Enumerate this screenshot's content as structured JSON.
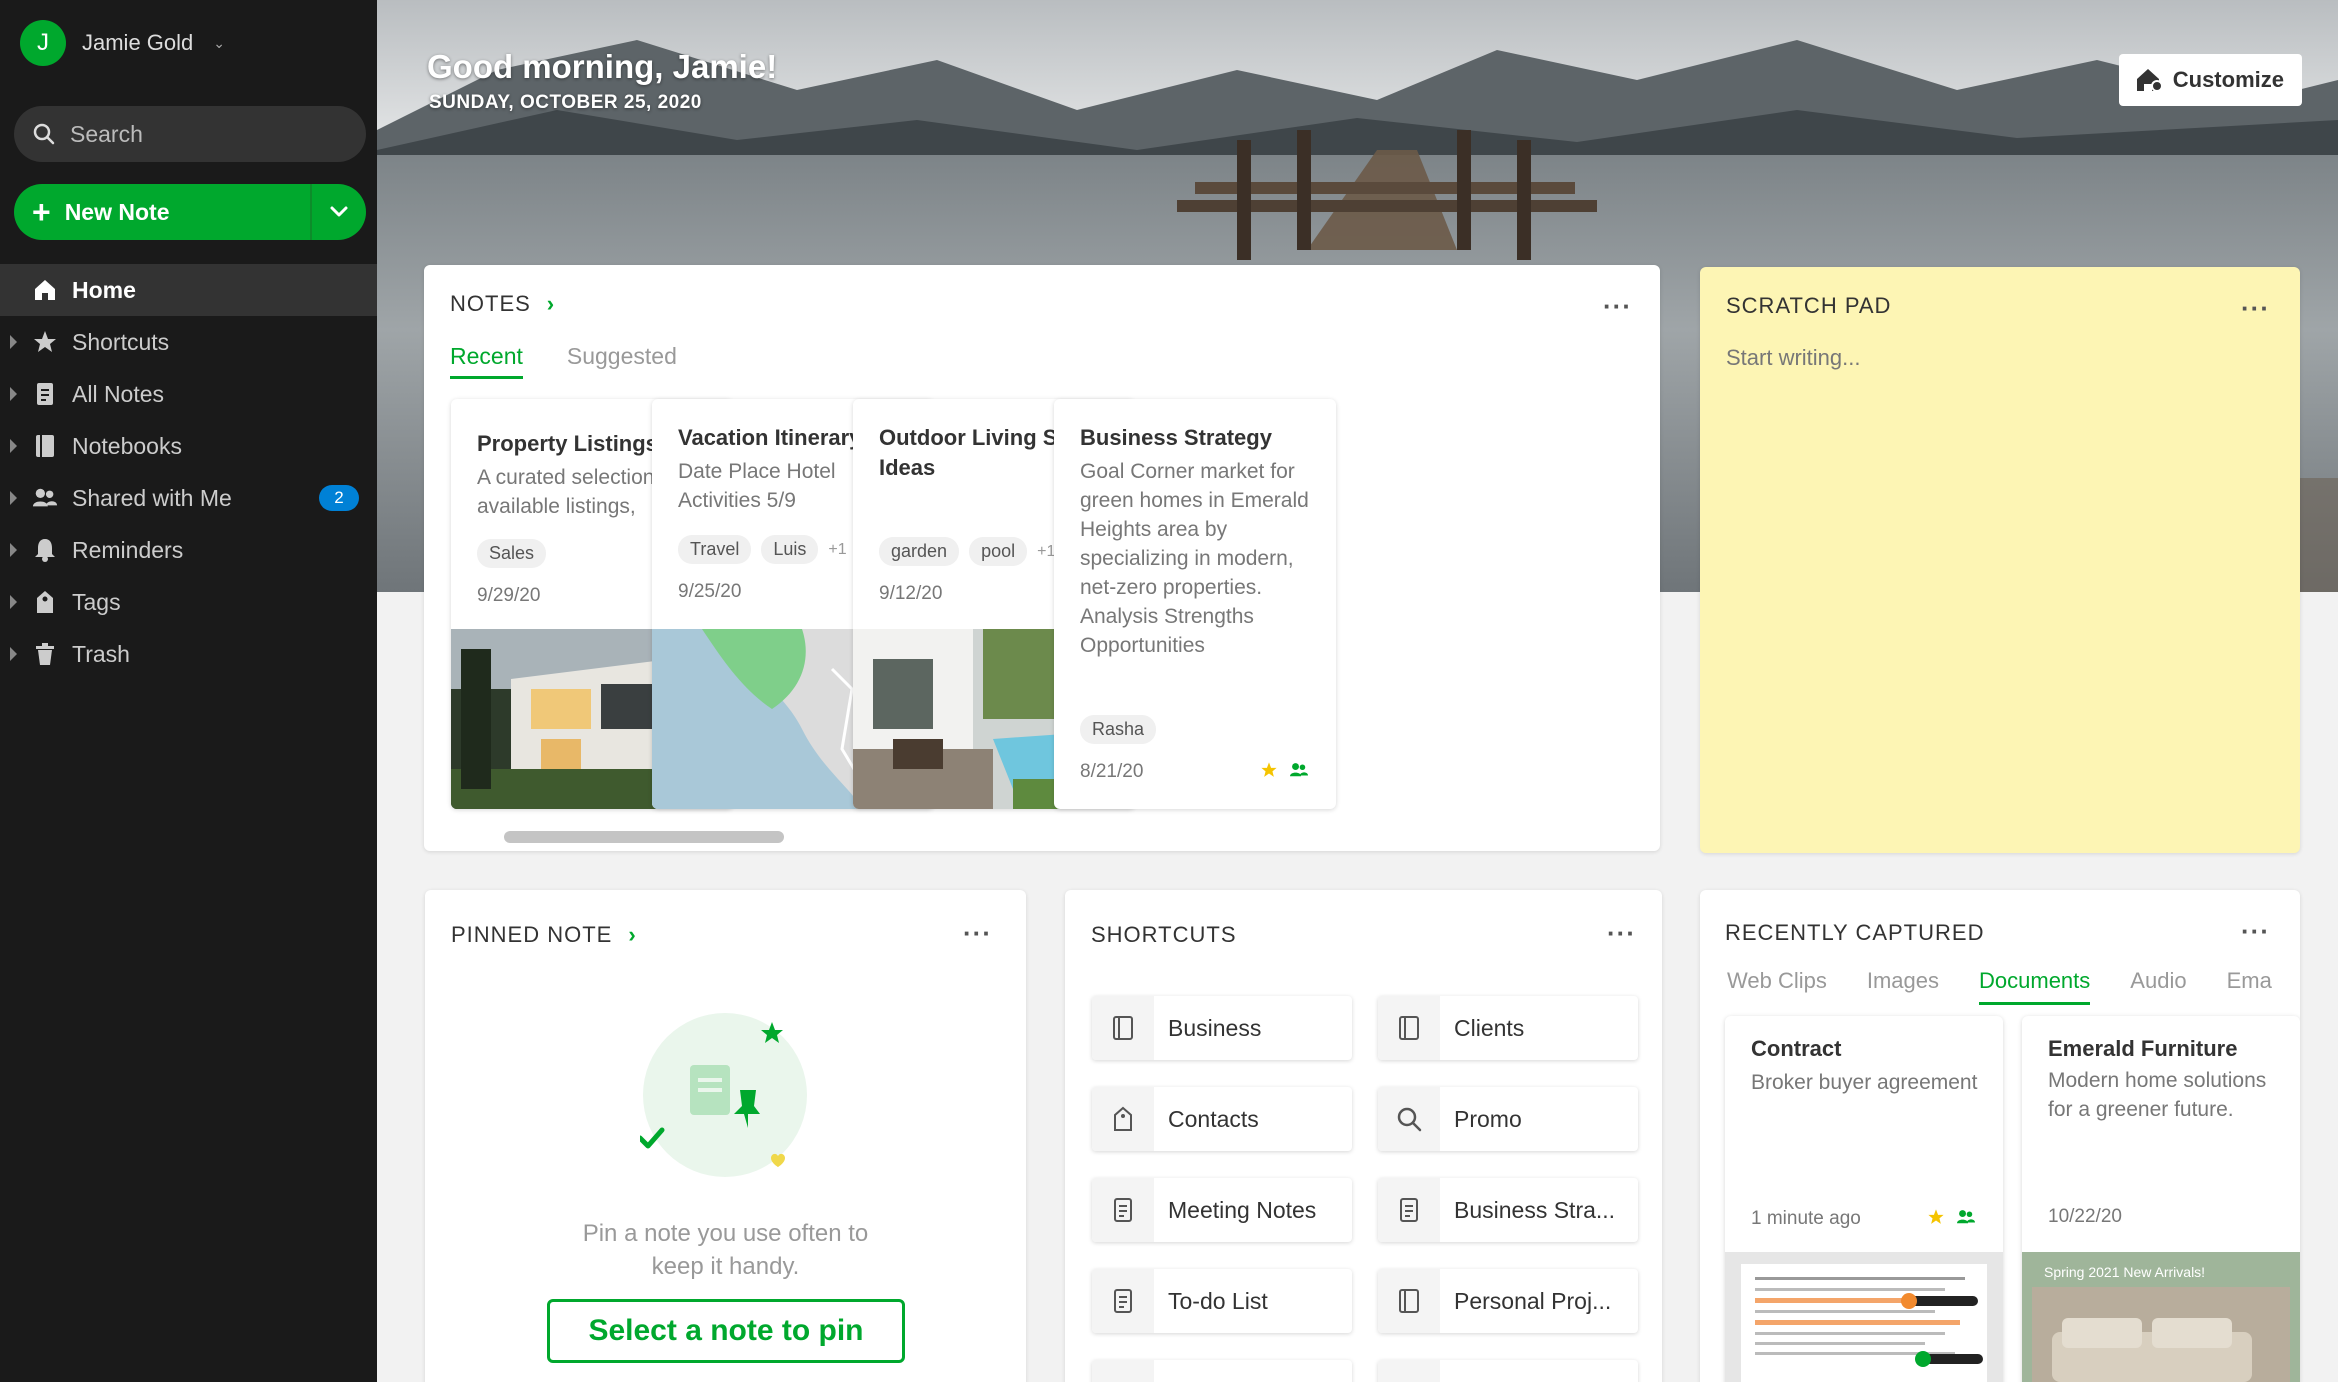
{
  "account": {
    "initial": "J",
    "name": "Jamie Gold"
  },
  "search": {
    "placeholder": "Search"
  },
  "new_note": {
    "label": "New Note"
  },
  "nav": [
    {
      "label": "Home",
      "icon": "home-icon"
    },
    {
      "label": "Shortcuts",
      "icon": "star-icon"
    },
    {
      "label": "All Notes",
      "icon": "note-icon"
    },
    {
      "label": "Notebooks",
      "icon": "notebook-icon"
    },
    {
      "label": "Shared with Me",
      "icon": "people-icon",
      "badge": "2"
    },
    {
      "label": "Reminders",
      "icon": "bell-icon"
    },
    {
      "label": "Tags",
      "icon": "tag-icon"
    },
    {
      "label": "Trash",
      "icon": "trash-icon"
    }
  ],
  "hero": {
    "greeting": "Good morning, Jamie!",
    "date": "SUNDAY, OCTOBER 25, 2020",
    "customize_label": "Customize"
  },
  "notes": {
    "title": "NOTES",
    "tabs": [
      "Recent",
      "Suggested"
    ],
    "items": [
      {
        "title": "Property Listings",
        "snippet": "A curated selection of available listings,",
        "tags": [
          "Sales"
        ],
        "tags_more": "",
        "date": "9/29/20"
      },
      {
        "title": "Vacation Itinerary",
        "snippet": "Date Place Hotel Activities 5/9",
        "tags": [
          "Travel",
          "Luis"
        ],
        "tags_more": "+1",
        "date": "9/25/20"
      },
      {
        "title": "Outdoor Living Space Ideas",
        "snippet": "",
        "tags": [
          "garden",
          "pool"
        ],
        "tags_more": "+1",
        "date": "9/12/20"
      },
      {
        "title": "Business Strategy",
        "snippet": "Goal Corner market for green homes in Emerald Heights area by specializing in modern, net-zero properties. Analysis Strengths Opportunities",
        "tags": [
          "Rasha"
        ],
        "tags_more": "",
        "date": "8/21/20"
      }
    ]
  },
  "scratch": {
    "title": "SCRATCH PAD",
    "placeholder": "Start writing..."
  },
  "pinned": {
    "title": "PINNED NOTE",
    "text_line1": "Pin a note you use often to",
    "text_line2": "keep it handy.",
    "button_label": "Select a note to pin"
  },
  "shortcuts": {
    "title": "SHORTCUTS",
    "items": [
      {
        "label": "Business",
        "icon": "notebook-icon"
      },
      {
        "label": "Clients",
        "icon": "notebook-icon"
      },
      {
        "label": "Contacts",
        "icon": "tag-icon"
      },
      {
        "label": "Promo",
        "icon": "search-icon"
      },
      {
        "label": "Meeting Notes",
        "icon": "note-icon"
      },
      {
        "label": "Business Stra...",
        "icon": "note-icon"
      },
      {
        "label": "To-do List",
        "icon": "note-icon"
      },
      {
        "label": "Personal Proj...",
        "icon": "notebook-icon"
      }
    ]
  },
  "recent": {
    "title": "RECENTLY CAPTURED",
    "tabs": [
      "Web Clips",
      "Images",
      "Documents",
      "Audio",
      "Ema"
    ],
    "items": [
      {
        "title": "Contract",
        "snippet": "Broker buyer agreement",
        "date": "1 minute ago",
        "preview_badge": ""
      },
      {
        "title": "Emerald Furniture",
        "snippet": "Modern home solutions for a greener future.",
        "date": "10/22/20",
        "preview_badge": "Spring 2021 New Arrivals!"
      }
    ]
  },
  "colors": {
    "accent": "#00a82d",
    "sidebar": "#1a1a1a",
    "scratch": "#fdf5b4",
    "badge": "#0081d6",
    "star": "#f5c400"
  }
}
